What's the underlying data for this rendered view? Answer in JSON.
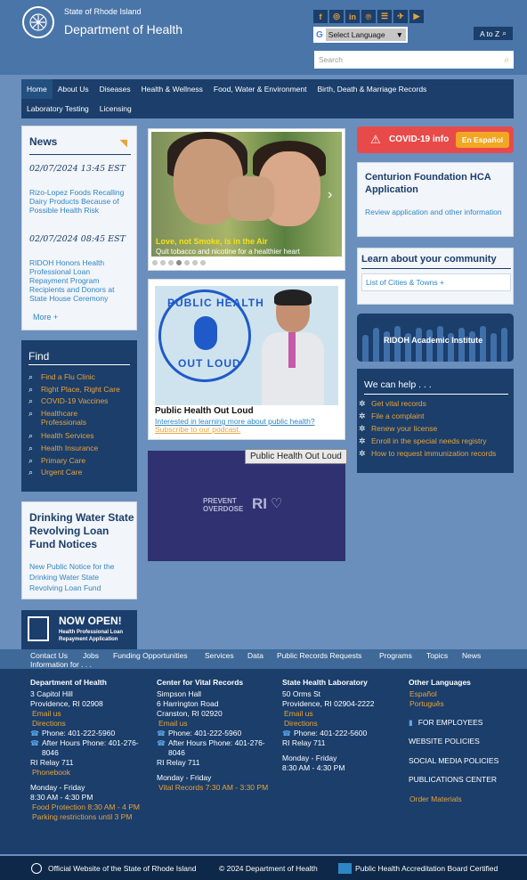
{
  "header": {
    "state": "State of Rhode Island",
    "dept": "Department of Health",
    "lang_label": "Select Language",
    "atoz": "A to Z",
    "search_placeholder": "Search",
    "social_icons": [
      "facebook-icon",
      "instagram-icon",
      "linkedin-icon",
      "pinterest-icon",
      "rss-icon",
      "twitter-icon",
      "youtube-icon"
    ]
  },
  "nav": {
    "row1": [
      "Home",
      "About Us",
      "Diseases",
      "Health & Wellness",
      "Food, Water & Environment",
      "Birth, Death & Marriage Records"
    ],
    "row2": [
      "Laboratory Testing",
      "Licensing"
    ]
  },
  "news": {
    "title": "News",
    "items": [
      {
        "date": "02/07/2024 13:45 EST",
        "text": "Rizo-Lopez Foods Recalling Dairy Products Because of Possible Health Risk"
      },
      {
        "date": "02/07/2024 08:45 EST",
        "text": "RIDOH Honors Health Professional Loan Repayment Program Recipients and Donors at State House Ceremony"
      }
    ],
    "more": "More +"
  },
  "find": {
    "title": "Find",
    "items": [
      "Find a Flu Clinic",
      "Right Place, Right Care",
      "COVID-19 Vaccines",
      "Healthcare Professionals",
      "Health Services",
      "Health Insurance",
      "Primary Care",
      "Urgent Care"
    ]
  },
  "water": {
    "title": "Drinking Water State Revolving Loan Fund Notices",
    "text": "New Public Notice for the Drinking Water State Revolving Loan Fund"
  },
  "nowopen": {
    "title": "NOW OPEN!",
    "sub": "Health Professional Loan Repayment Application"
  },
  "slider": {
    "caption1": "Love, not Smoke, is in the Air",
    "caption2": "Quit tobacco and nicotine for a healthier heart",
    "dots": 7,
    "active": 3
  },
  "podcast": {
    "img_text1": "PUBLIC HEALTH",
    "img_text2": "OUT LOUD",
    "title": "Public Health Out Loud",
    "line1": "Interested in learning more about public health?",
    "line2": "Subscribe to our podcast.",
    "tooltip": "Public Health Out Loud"
  },
  "prevent": {
    "line1": "PREVENT",
    "line2": "OVERDOSE",
    "ri": "RI"
  },
  "covid": {
    "label": "COVID-19 info",
    "espanol": "En Español"
  },
  "centurion": {
    "title": "Centurion Foundation HCA Application",
    "text": "Review application and other information"
  },
  "learn": {
    "title": "Learn about your community",
    "link": "List of Cities & Towns +"
  },
  "ridoh": {
    "label": "RIDOH Academic Institute"
  },
  "help": {
    "title": "We can help . . .",
    "items": [
      "Get vital records",
      "File a complaint",
      "Renew your license",
      "Enroll in the special needs registry",
      "How to request immunization records"
    ]
  },
  "footnav": [
    "Contact Us",
    "Jobs",
    "Funding Opportunities",
    "Services",
    "Data",
    "Public Records Requests",
    "Programs",
    "Topics",
    "News",
    "Information for . . ."
  ],
  "footer": {
    "col1": {
      "title": "Department of Health",
      "addr1": "3 Capitol Hill",
      "addr2": "Providence, RI 02908",
      "email": "Email us",
      "directions": "Directions",
      "phone": "Phone: 401-222-5960",
      "afterhours": "After Hours Phone: 401-276-8046",
      "relay": "RI Relay 711",
      "phonebook": "Phonebook",
      "hours1": "Monday - Friday",
      "hours2": "8:30 AM - 4:30 PM",
      "food": "Food Protection 8:30 AM - 4 PM",
      "parking": "Parking restrictions until 3 PM"
    },
    "col2": {
      "title": "Center for Vital Records",
      "addr1": "Simpson Hall",
      "addr2": "6 Harrington Road",
      "addr3": "Cranston, RI 02920",
      "email": "Email us",
      "phone": "Phone: 401-222-5960",
      "afterhours": "After Hours Phone: 401-276-8046",
      "relay": "RI Relay 711",
      "hours1": "Monday - Friday",
      "vital": "Vital Records 7:30 AM - 3:30 PM"
    },
    "col3": {
      "title": "State Health Laboratory",
      "addr1": "50 Orms St",
      "addr2": "Providence, RI 02904-2222",
      "email": "Email us",
      "directions": "Directions",
      "phone": "Phone: 401-222-5600",
      "relay": "RI Relay 711",
      "hours1": "Monday - Friday",
      "hours2": "8:30 AM - 4:30 PM"
    },
    "col4": {
      "title": "Other Languages",
      "espanol": "Español",
      "portugues": "Português",
      "employees": "FOR EMPLOYEES",
      "website": "WEBSITE POLICIES",
      "social": "SOCIAL MEDIA POLICIES",
      "pubs": "PUBLICATIONS CENTER",
      "order": "Order Materials"
    }
  },
  "bottom": {
    "official": "Official Website of the State of Rhode Island",
    "copy": "© 2024 Department of Health",
    "accred": "Public Health Accreditation Board Certified"
  },
  "colors": {
    "navy": "#1b3e6b",
    "orange": "#e8a33a",
    "link": "#2f86c5",
    "red": "#e84a4a",
    "bg": "#6a8fbd"
  }
}
